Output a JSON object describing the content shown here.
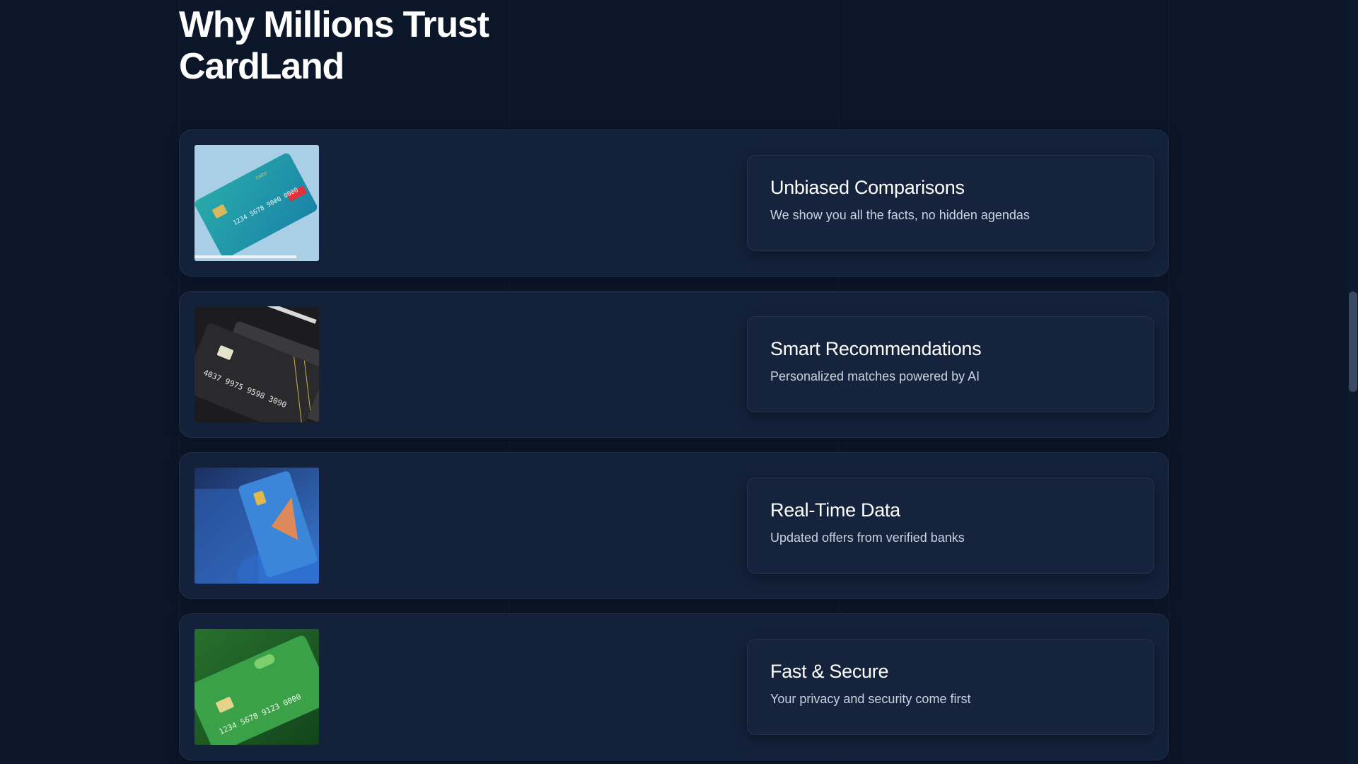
{
  "section": {
    "title": "Why Millions Trust CardLand"
  },
  "features": [
    {
      "title": "Unbiased Comparisons",
      "description": "We show you all the facts, no hidden agendas",
      "image_icon": "teal-credit-card-image"
    },
    {
      "title": "Smart Recommendations",
      "description": "Personalized matches powered by AI",
      "image_icon": "black-credit-card-image"
    },
    {
      "title": "Real-Time Data",
      "description": "Updated offers from verified banks",
      "image_icon": "blue-credit-card-image"
    },
    {
      "title": "Fast & Secure",
      "description": "Your privacy and security come first",
      "image_icon": "green-credit-card-image"
    }
  ],
  "colors": {
    "background": "#0b1628",
    "card": "#14213a",
    "panel": "#16233c",
    "heading": "#ffffff",
    "text_muted": "#c9d2e0"
  }
}
